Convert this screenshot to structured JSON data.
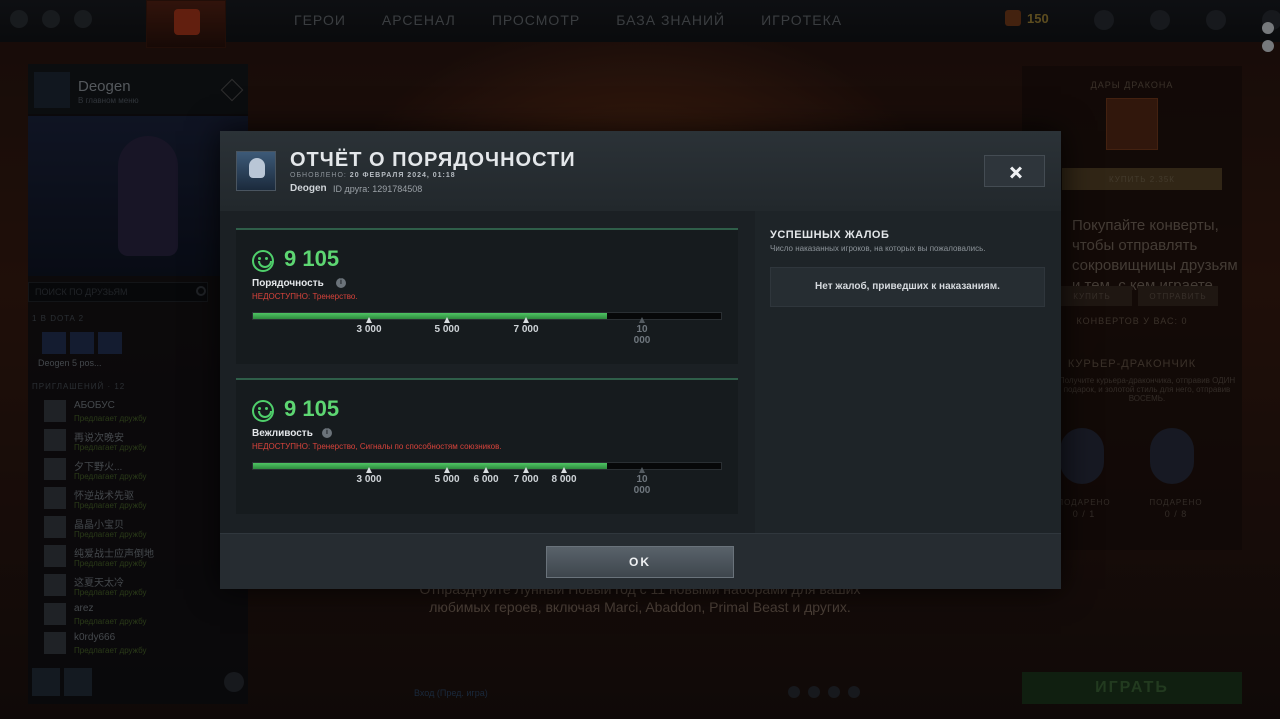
{
  "topbar": {
    "nav": [
      "ГЕРОИ",
      "АРСЕНАЛ",
      "ПРОСМОТР",
      "БАЗА ЗНАНИЙ",
      "ИГРОТЕКА"
    ],
    "currency": "150"
  },
  "sidebar": {
    "profile_name": "Deogen",
    "profile_status": "В главном меню",
    "search_placeholder": "ПОИСК ПО ДРУЗЬЯМ",
    "party_group": "1 В DOTA 2",
    "party_text": "Deogen 5 pos...",
    "invites_group": "ПРИГЛАШЕНИЙ · 12",
    "friends": [
      {
        "name": "АБОБУС",
        "status": "Предлагает дружбу"
      },
      {
        "name": "再说次晚安",
        "status": "Предлагает дружбу"
      },
      {
        "name": "夕下野火...",
        "status": "Предлагает дружбу"
      },
      {
        "name": "怀逆战术先驱",
        "status": "Предлагает дружбу"
      },
      {
        "name": "晶晶小宝贝",
        "status": "Предлагает дружбу"
      },
      {
        "name": "纯爱战士应声倒地",
        "status": "Предлагает дружбу"
      },
      {
        "name": "这夏天太冷",
        "status": "Предлагает дружбу"
      },
      {
        "name": "arez",
        "status": "Предлагает дружбу"
      },
      {
        "name": "k0rdy666",
        "status": "Предлагает дружбу"
      }
    ]
  },
  "right_panel": {
    "title": "ДАРЫ ДРАКОНА",
    "buy_label": "КУПИТЬ 2.35К",
    "promo": "Покупайте конверты, чтобы отправлять сокровищницы друзьям и тем, с кем играете.",
    "buy_btn": "КУПИТЬ",
    "send_btn": "ОТПРАВИТЬ",
    "envelopes": "КОНВЕРТОВ У ВАС: 0",
    "courier_title": "КУРЬЕР-ДРАКОНЧИК",
    "courier_text": "Получите курьера-дракончика, отправив ОДИН подарок, и золотой стиль для него, отправив ВОСЕМЬ.",
    "gift1_label": "ПОДАРЕНО",
    "gift1_value": "0 / 1",
    "gift2_label": "ПОДАРЕНО",
    "gift2_value": "0 / 8",
    "play": "ИГРАТЬ"
  },
  "background": {
    "news": "Отпразднуйте Лунный Новый год с 11 новыми наборами для ваших любимых героев, включая Marci, Abaddon, Primal Beast и других.",
    "bottom_status": "Вход (Пред. игра)"
  },
  "modal": {
    "title": "ОТЧЁТ О ПОРЯДОЧНОСТИ",
    "updated_label": "ОБНОВЛЕНО:",
    "updated_value": "20 ФЕВРАЛЯ 2024, 01:18",
    "player_name": "Deogen",
    "friend_id": "ID друга: 1291784508",
    "close_label": "Закрыть",
    "ok_label": "OK",
    "cards": [
      {
        "score": "9 105",
        "label": "Порядочность",
        "unavailable_label": "НЕДОСТУПНО:",
        "unavailable_value": "Тренерство.",
        "fill_fraction": 0.7574,
        "ticks": [
          "3 000",
          "5 000",
          "7 000"
        ],
        "max_tick": "10 000"
      },
      {
        "score": "9 105",
        "label": "Вежливость",
        "unavailable_label": "НЕДОСТУПНО:",
        "unavailable_value": "Тренерство, Сигналы по способностям союзников.",
        "fill_fraction": 0.7574,
        "ticks": [
          "3 000",
          "5 000",
          "6 000",
          "7 000",
          "8 000"
        ],
        "max_tick": "10 000"
      }
    ],
    "complaints": {
      "title": "УСПЕШНЫХ ЖАЛОБ",
      "subtitle": "Число наказанных игроков, на которых вы пожаловались.",
      "empty": "Нет жалоб, приведших к наказаниям."
    }
  }
}
